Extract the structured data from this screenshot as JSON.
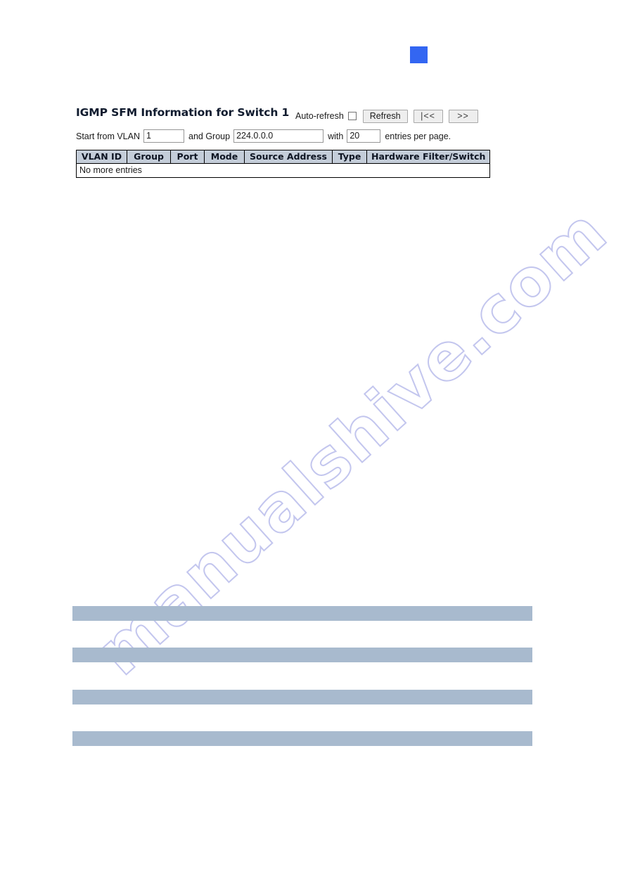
{
  "watermark": {
    "text": "manualshive.com"
  },
  "marker": {
    "name": "blue-square-marker",
    "color": "#3366f2"
  },
  "panel": {
    "title": "IGMP SFM Information for Switch 1"
  },
  "toolbar": {
    "autorefresh_label": "Auto-refresh",
    "autorefresh_checked": false,
    "refresh_label": "Refresh",
    "first_page_label": "|<<",
    "next_page_label": ">>"
  },
  "filter": {
    "start_from_vlan_label": "Start from VLAN",
    "vlan_value": "1",
    "and_group_label": "and Group",
    "group_value": "224.0.0.0",
    "with_label": "with",
    "entries_value": "20",
    "entries_per_page_label": "entries per page."
  },
  "table": {
    "columns": [
      "VLAN ID",
      "Group",
      "Port",
      "Mode",
      "Source Address",
      "Type",
      "Hardware Filter/Switch"
    ],
    "empty_message": "No more entries",
    "rows": [],
    "header_background": "#c4cdd9"
  },
  "bottom_bars": {
    "color": "#a8bace",
    "count": 4,
    "tops": [
      862,
      921,
      981,
      1040
    ]
  }
}
